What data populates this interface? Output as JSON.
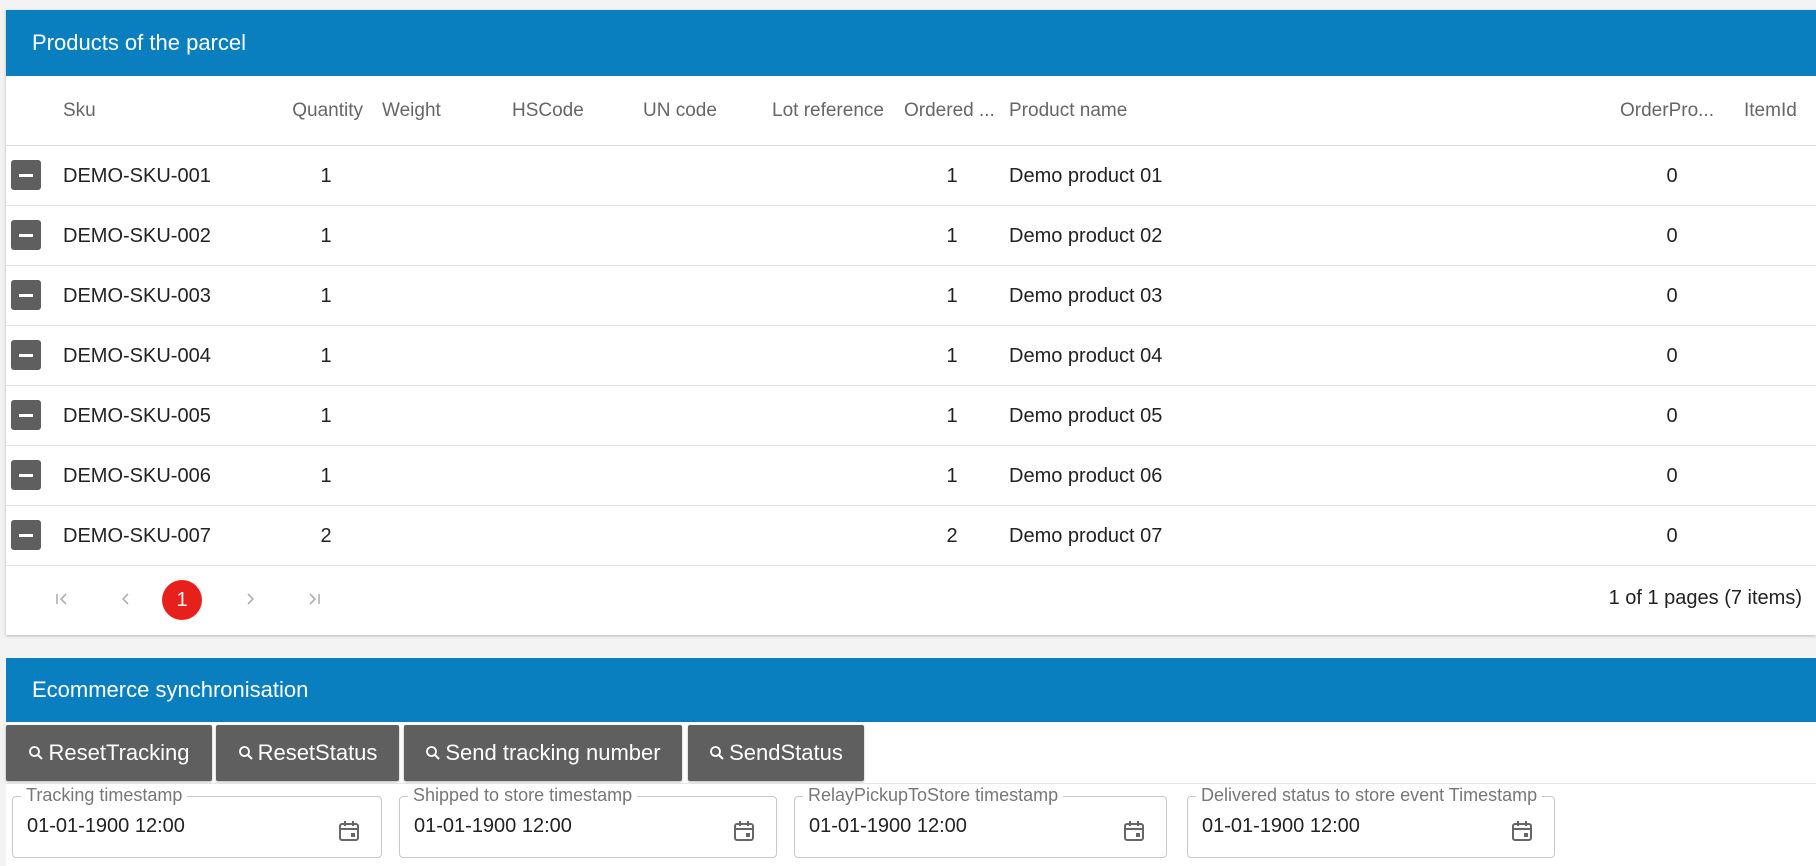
{
  "products": {
    "title": "Products of the parcel",
    "columns": [
      "Sku",
      "Quantity",
      "Weight",
      "HSCode",
      "UN code",
      "Lot reference",
      "Ordered ...",
      "Product name",
      "OrderPro...",
      "ItemId"
    ],
    "rows": [
      {
        "sku": "DEMO-SKU-001",
        "quantity": "1",
        "ordered": "1",
        "product_name": "Demo product 01",
        "order_pro": "0"
      },
      {
        "sku": "DEMO-SKU-002",
        "quantity": "1",
        "ordered": "1",
        "product_name": "Demo product 02",
        "order_pro": "0"
      },
      {
        "sku": "DEMO-SKU-003",
        "quantity": "1",
        "ordered": "1",
        "product_name": "Demo product 03",
        "order_pro": "0"
      },
      {
        "sku": "DEMO-SKU-004",
        "quantity": "1",
        "ordered": "1",
        "product_name": "Demo product 04",
        "order_pro": "0"
      },
      {
        "sku": "DEMO-SKU-005",
        "quantity": "1",
        "ordered": "1",
        "product_name": "Demo product 05",
        "order_pro": "0"
      },
      {
        "sku": "DEMO-SKU-006",
        "quantity": "1",
        "ordered": "1",
        "product_name": "Demo product 06",
        "order_pro": "0"
      },
      {
        "sku": "DEMO-SKU-007",
        "quantity": "2",
        "ordered": "2",
        "product_name": "Demo product 07",
        "order_pro": "0"
      }
    ],
    "pager": {
      "first": "|<",
      "prev": "<",
      "current_page": "1",
      "next": ">",
      "last": ">|",
      "summary": "1 of 1 pages (7 items)"
    }
  },
  "ecommerce": {
    "title": "Ecommerce synchronisation",
    "buttons": [
      "ResetTracking",
      "ResetStatus",
      "Send tracking number",
      "SendStatus"
    ],
    "fields": [
      {
        "label": "Tracking timestamp",
        "value": "01-01-1900 12:00"
      },
      {
        "label": "Shipped to store timestamp",
        "value": "01-01-1900 12:00"
      },
      {
        "label": "RelayPickupToStore timestamp",
        "value": "01-01-1900 12:00"
      },
      {
        "label": "Delivered status to store event Timestamp",
        "value": "01-01-1900 12:00"
      }
    ]
  },
  "icons": {
    "row_action": "minus-icon",
    "button_icon": "search-icon",
    "field_icon": "calendar-icon"
  },
  "colors": {
    "header_blue": "#0a7fc0",
    "button_gray": "#5f5f5f",
    "active_page_red": "#e8201c"
  }
}
